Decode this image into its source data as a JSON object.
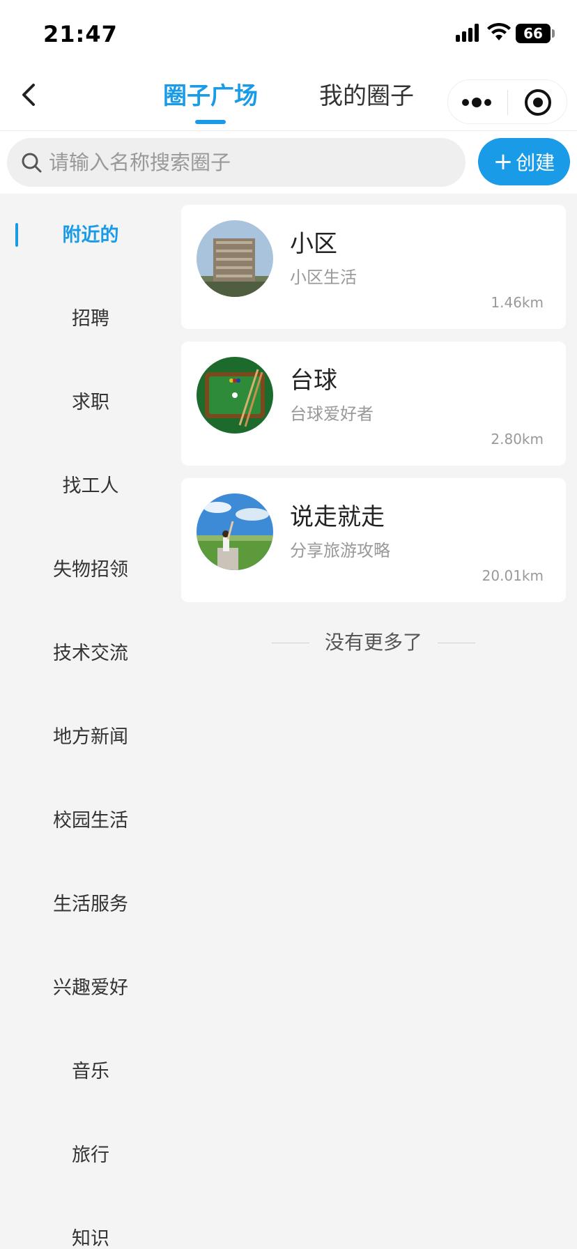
{
  "status_bar": {
    "time": "21:47",
    "battery": "66"
  },
  "nav": {
    "tabs": [
      {
        "label": "圈子广场",
        "active": true
      },
      {
        "label": "我的圈子",
        "active": false
      }
    ]
  },
  "search": {
    "placeholder": "请输入名称搜索圈子"
  },
  "create_button": {
    "label": "创建"
  },
  "sidebar": {
    "items": [
      {
        "label": "附近的",
        "active": true
      },
      {
        "label": "招聘"
      },
      {
        "label": "求职"
      },
      {
        "label": "找工人"
      },
      {
        "label": "失物招领"
      },
      {
        "label": "技术交流"
      },
      {
        "label": "地方新闻"
      },
      {
        "label": "校园生活"
      },
      {
        "label": "生活服务"
      },
      {
        "label": "兴趣爱好"
      },
      {
        "label": "音乐"
      },
      {
        "label": "旅行"
      },
      {
        "label": "知识"
      }
    ]
  },
  "circles": [
    {
      "title": "小区",
      "subtitle": "小区生活",
      "distance": "1.46km",
      "avatar_icon": "building-photo"
    },
    {
      "title": "台球",
      "subtitle": "台球爱好者",
      "distance": "2.80km",
      "avatar_icon": "billiards-table-photo"
    },
    {
      "title": "说走就走",
      "subtitle": "分享旅游攻略",
      "distance": "20.01km",
      "avatar_icon": "travel-landscape-photo"
    }
  ],
  "footer": {
    "no_more_text": "没有更多了"
  },
  "colors": {
    "accent": "#1a9be8",
    "background": "#f4f4f4"
  }
}
